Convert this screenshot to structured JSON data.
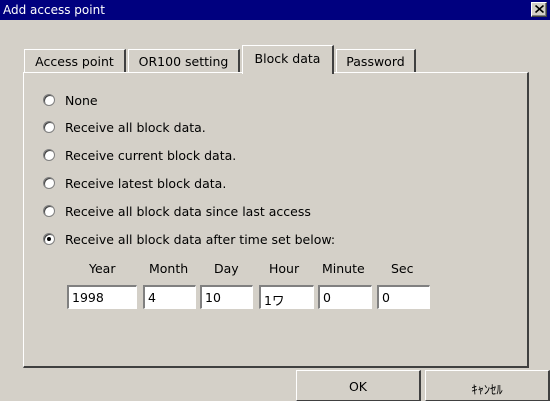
{
  "window": {
    "title": "Add access point",
    "close_icon": "close-icon"
  },
  "tabs": [
    {
      "label": "Access point",
      "active": false
    },
    {
      "label": "OR100 setting",
      "active": false
    },
    {
      "label": "Block data",
      "active": true
    },
    {
      "label": "Password",
      "active": false
    }
  ],
  "options": [
    {
      "label": "None",
      "selected": false
    },
    {
      "label": "Receive all block data.",
      "selected": false
    },
    {
      "label": "Receive current block data.",
      "selected": false
    },
    {
      "label": "Receive latest block data.",
      "selected": false
    },
    {
      "label": "Receive all block data since last access",
      "selected": false
    },
    {
      "label": "Receive all block data after time set below:",
      "selected": true
    }
  ],
  "time_fields": {
    "year": {
      "label": "Year",
      "value": "1998"
    },
    "month": {
      "label": "Month",
      "value": "4"
    },
    "day": {
      "label": "Day",
      "value": "10"
    },
    "hour": {
      "label": "Hour",
      "value": "1ワ"
    },
    "minute": {
      "label": "Minute",
      "value": "0"
    },
    "sec": {
      "label": "Sec",
      "value": "0"
    }
  },
  "buttons": {
    "ok": "OK",
    "cancel": "ｷｬﾝｾﾙ"
  }
}
